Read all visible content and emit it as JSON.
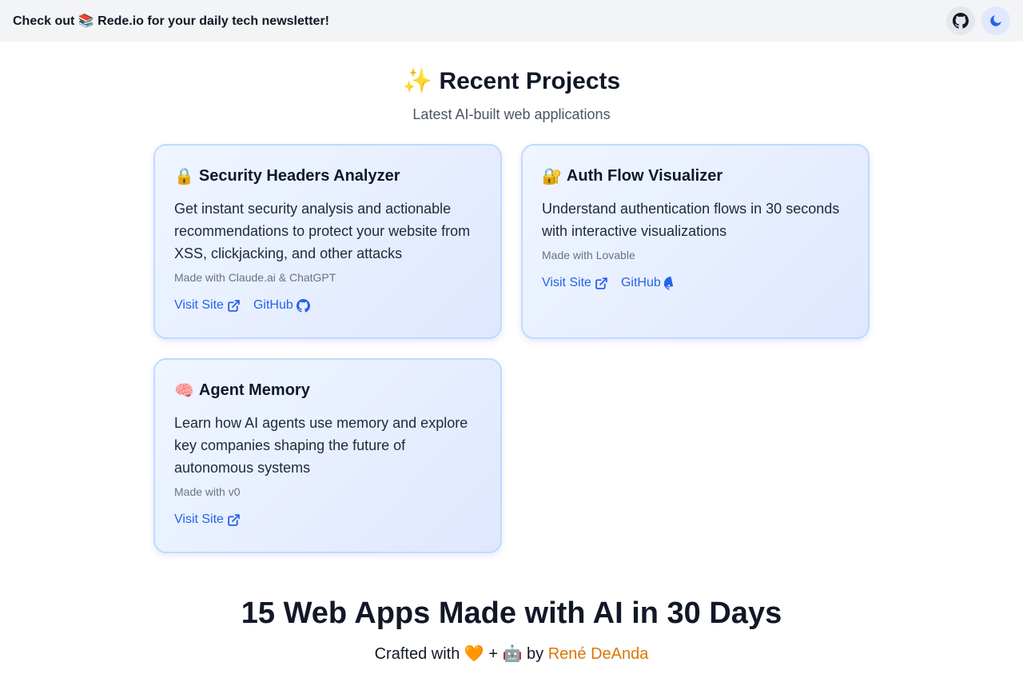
{
  "banner": {
    "text": "Check out 📚 Rede.io for your daily tech newsletter!"
  },
  "header_icons": {
    "github": "github-icon",
    "theme": "moon-icon"
  },
  "projects_section": {
    "title": "✨ Recent Projects",
    "subtitle": "Latest AI-built web applications"
  },
  "projects": [
    {
      "emoji": "🔒",
      "title": "Security Headers Analyzer",
      "description": "Get instant security analysis and actionable recommendations to protect your website from XSS, clickjacking, and other attacks",
      "made_with": "Made with Claude.ai & ChatGPT",
      "visit_label": "Visit Site",
      "github_label": "GitHub"
    },
    {
      "emoji": "🔐",
      "title": "Auth Flow Visualizer",
      "description": "Understand authentication flows in 30 seconds with interactive visualizations",
      "made_with": "Made with Lovable",
      "visit_label": "Visit Site",
      "github_label": "GitHub"
    },
    {
      "emoji": "🧠",
      "title": "Agent Memory",
      "description": "Learn how AI agents use memory and explore key companies shaping the future of autonomous systems",
      "made_with": "Made with v0",
      "visit_label": "Visit Site"
    }
  ],
  "footer": {
    "headline": "15 Web Apps Made with AI in 30 Days",
    "crafted_prefix": "Crafted with 🧡 + 🤖 by",
    "author": "René DeAnda"
  },
  "colors": {
    "accent": "#2563eb",
    "author": "#d97706",
    "card_border": "#bfdbfe"
  }
}
